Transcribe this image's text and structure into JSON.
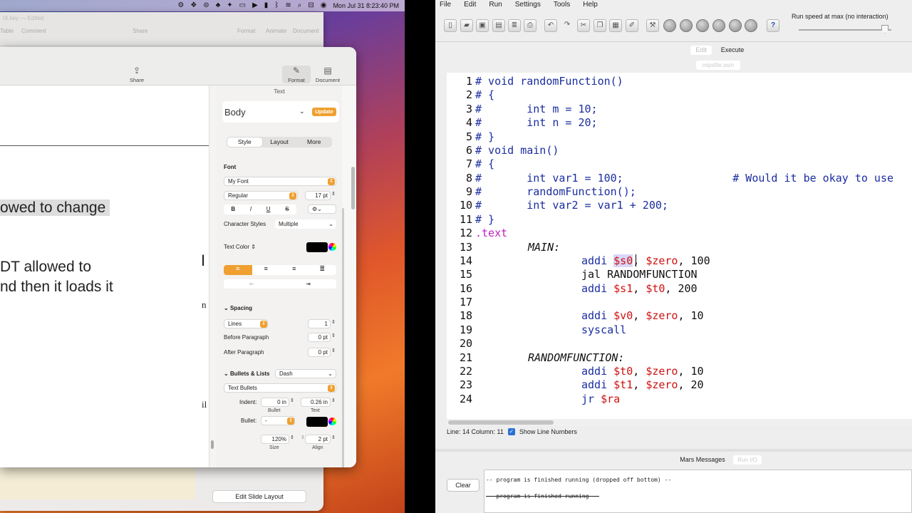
{
  "mac": {
    "menubar": {
      "datetime": "Mon Jul 31  8:23:40 PM"
    },
    "bg_window": {
      "title_fragment": "IX.key — Edited",
      "toolbar": [
        "Table",
        "Comment",
        "Share",
        "Format",
        "Animate",
        "Document"
      ],
      "edit_slide_layout": "Edit Slide Layout"
    },
    "keynote": {
      "toolbar": {
        "share": "Share",
        "format": "Format",
        "document": "Document"
      },
      "canvas_lines": [
        "owed to change",
        "DT allowed to",
        "nd then it loads it"
      ],
      "inspector": {
        "header": "Text",
        "paragraph_style": "Body",
        "update": "Update",
        "tabs": [
          "Style",
          "Layout",
          "More"
        ],
        "font_label": "Font",
        "font_name": "My Font",
        "font_weight": "Regular",
        "font_size": "17 pt",
        "format_buttons": [
          "B",
          "I",
          "U",
          "S"
        ],
        "character_styles_label": "Character Styles",
        "character_styles_value": "Multiple",
        "text_color_label": "Text Color",
        "text_color": "#000000",
        "spacing_label": "Spacing",
        "spacing_mode": "Lines",
        "spacing_value": "1",
        "before_paragraph_label": "Before Paragraph",
        "before_paragraph_value": "0 pt",
        "after_paragraph_label": "After Paragraph",
        "after_paragraph_value": "0 pt",
        "bullets_label": "Bullets & Lists",
        "bullets_value": "Dash",
        "text_bullets": "Text Bullets",
        "indent_label": "Indent:",
        "indent_bullet": "0 in",
        "indent_text": "0.26 in",
        "bullet_caption": "Bullet",
        "text_caption": "Text",
        "bullet_label": "Bullet:",
        "bullet_value": "-",
        "bullet_color": "#000000",
        "size_value": "120%",
        "size_caption": "Size",
        "align_value": "2 pt",
        "align_caption": "Align"
      }
    }
  },
  "mars": {
    "menu": [
      "File",
      "Edit",
      "Run",
      "Settings",
      "Tools",
      "Help"
    ],
    "run_speed": "Run speed at max (no interaction)",
    "tabs": {
      "edit": "Edit",
      "execute": "Execute",
      "file_tab": "mipsfile.asm"
    },
    "line_numbers": [
      "1",
      "2",
      "3",
      "4",
      "5",
      "6",
      "7",
      "8",
      "9",
      "10",
      "11",
      "12",
      "13",
      "14",
      "15",
      "16",
      "17",
      "18",
      "19",
      "20",
      "21",
      "22",
      "23",
      "24"
    ],
    "code": {
      "l1": "# void randomFunction()",
      "l2": "# {",
      "l3": "#       int m = 10;",
      "l4": "#       int n = 20;",
      "l5": "# }",
      "l6": "# void main()",
      "l7": "# {",
      "l8": "#       int var1 = 100;                 # Would it be okay to use",
      "l9": "#       randomFunction();",
      "l10": "#       int var2 = var1 + 200;",
      "l11": "# }",
      "l12": ".text",
      "l13_label": "MAIN:",
      "l14_op": "addi",
      "l14_r1": "$s0",
      "l14_r2": "$zero",
      "l14_imm": "100",
      "l15": "jal RANDOMFUNCTION",
      "l16_op": "addi",
      "l16_r1": "$s1",
      "l16_r2": "$t0",
      "l16_imm": "200",
      "l18_op": "addi",
      "l18_r1": "$v0",
      "l18_r2": "$zero",
      "l18_imm": "10",
      "l19": "syscall",
      "l21_label": "RANDOMFUNCTION:",
      "l22_op": "addi",
      "l22_r1": "$t0",
      "l22_r2": "$zero",
      "l22_imm": "10",
      "l23_op": "addi",
      "l23_r1": "$t1",
      "l23_r2": "$zero",
      "l23_imm": "20",
      "l24_op": "jr",
      "l24_r1": "$ra"
    },
    "status": {
      "position": "Line: 14 Column: 11",
      "show_line_numbers": "Show Line Numbers"
    },
    "messages": {
      "title": "Mars Messages",
      "run_io_tab": "Run I/O",
      "clear": "Clear",
      "line1": "-- program is finished running (dropped off bottom) --",
      "line2": "-- program is finished running --"
    }
  }
}
